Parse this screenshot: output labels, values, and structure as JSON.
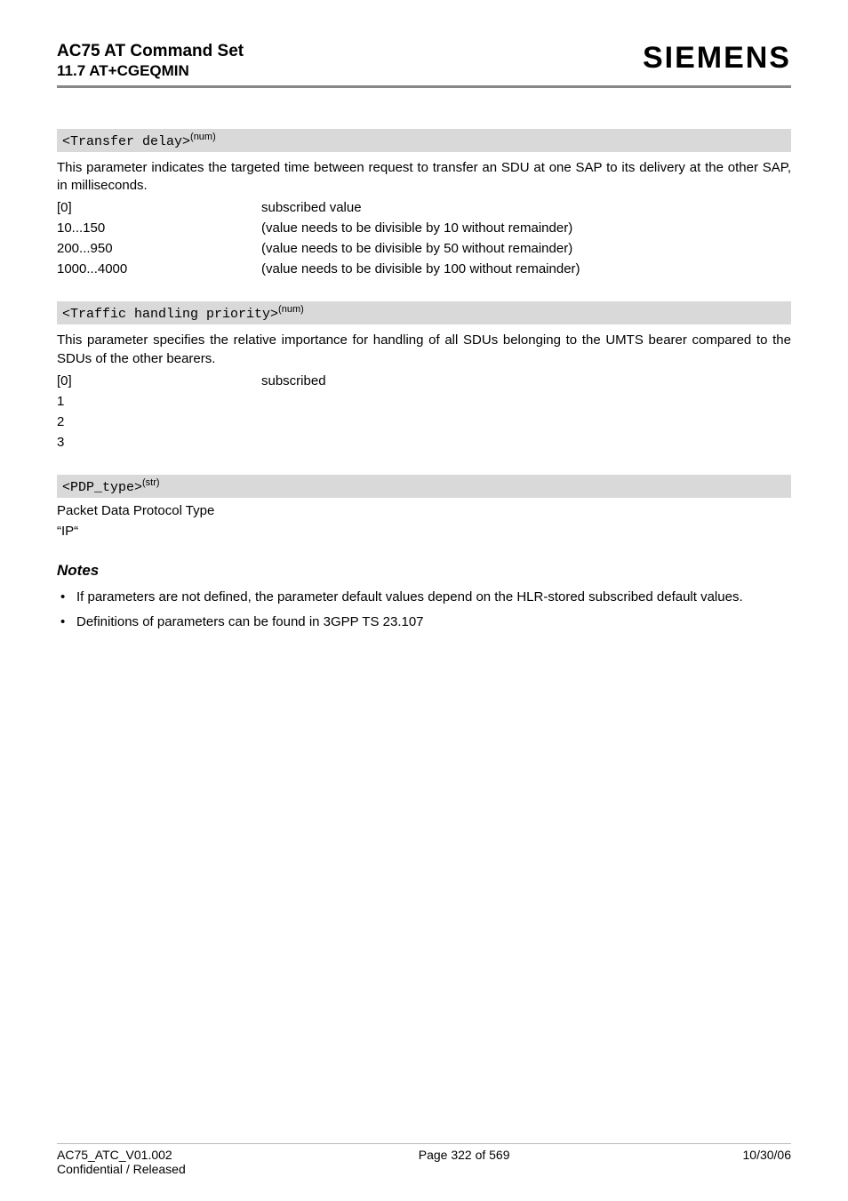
{
  "header": {
    "title": "AC75 AT Command Set",
    "subtitle": "11.7 AT+CGEQMIN",
    "brand": "SIEMENS"
  },
  "params": [
    {
      "name": "<Transfer delay>",
      "sup": "(num)",
      "desc": "This parameter indicates the targeted time between request to transfer an SDU at one SAP to its delivery at the other SAP, in milliseconds.",
      "rows": [
        {
          "k": "[0]",
          "v": "subscribed value"
        },
        {
          "k": "10...150",
          "v": "(value needs to be divisible by 10 without remainder)"
        },
        {
          "k": "200...950",
          "v": "(value needs to be divisible by 50 without remainder)"
        },
        {
          "k": "1000...4000",
          "v": "(value needs to be divisible by 100 without remainder)"
        }
      ]
    },
    {
      "name": "<Traffic handling priority>",
      "sup": "(num)",
      "desc": "This parameter specifies the relative importance for handling of all SDUs belonging to the UMTS bearer compared to the SDUs of the other bearers.",
      "rows": [
        {
          "k": "[0]",
          "v": "subscribed"
        },
        {
          "k": "1",
          "v": ""
        },
        {
          "k": "2",
          "v": ""
        },
        {
          "k": "3",
          "v": ""
        }
      ]
    },
    {
      "name": "<PDP_type>",
      "sup": "(str)",
      "desc": "",
      "lines": [
        "Packet Data Protocol Type",
        "“IP“"
      ]
    }
  ],
  "notes": {
    "heading": "Notes",
    "items": [
      "If parameters are not defined, the parameter default values depend on the HLR-stored subscribed default values.",
      "Definitions of parameters can be found in 3GPP TS 23.107"
    ]
  },
  "footer": {
    "left1": "AC75_ATC_V01.002",
    "left2": "Confidential / Released",
    "center": "Page 322 of 569",
    "right": "10/30/06"
  }
}
